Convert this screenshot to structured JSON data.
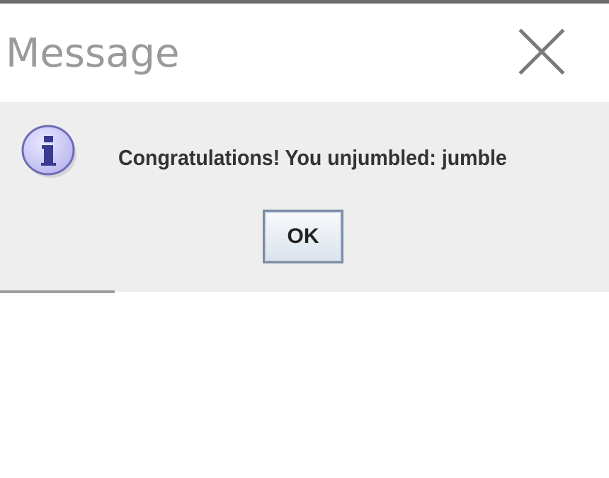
{
  "dialog": {
    "title": "Message",
    "message": "Congratulations! You unjumbled: jumble",
    "ok_label": "OK",
    "icon": "info-icon",
    "close_icon": "close-icon"
  },
  "colors": {
    "body_background": "#eeeeee",
    "title_text": "#9a9a9a",
    "icon_fill": "#c9c7f2",
    "icon_stroke": "#6e6bb8"
  }
}
